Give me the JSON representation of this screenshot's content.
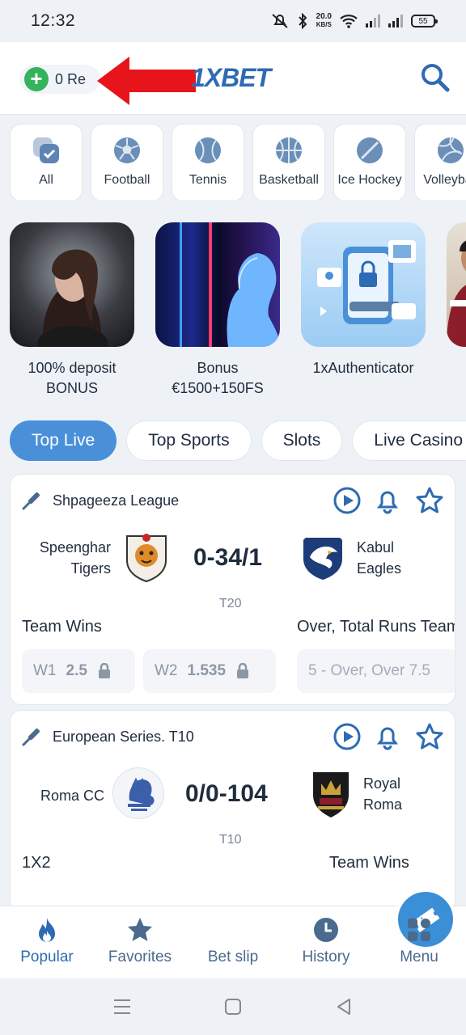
{
  "status": {
    "time": "12:32",
    "net_speed": "20.0",
    "net_unit": "KB/S",
    "battery": "55"
  },
  "header": {
    "balance": "0 Re",
    "logo": "1XBET",
    "arrow_color": "#e8141c"
  },
  "categories": [
    {
      "label": "All",
      "icon": "all-sports-icon"
    },
    {
      "label": "Football",
      "icon": "football-icon"
    },
    {
      "label": "Tennis",
      "icon": "tennis-icon"
    },
    {
      "label": "Basketball",
      "icon": "basketball-icon"
    },
    {
      "label": "Ice Hockey",
      "icon": "ice-hockey-icon"
    },
    {
      "label": "Volleyball",
      "icon": "volleyball-icon"
    }
  ],
  "promos": [
    {
      "title": "100% deposit\nBONUS"
    },
    {
      "title": "Bonus\n€1500+150FS"
    },
    {
      "title": "1xAuthenticator"
    }
  ],
  "tabs": [
    {
      "label": "Top Live",
      "active": true
    },
    {
      "label": "Top Sports"
    },
    {
      "label": "Slots"
    },
    {
      "label": "Live Casino"
    }
  ],
  "matches": [
    {
      "league": "Shpageeza League",
      "team1": "Speenghar\nTigers",
      "team2": "Kabul\nEagles",
      "score": "0-34/1",
      "format": "T20",
      "market1": "Team Wins",
      "market2": "Over, Total Runs Team",
      "odds": [
        {
          "k": "W1",
          "v": "2.5"
        },
        {
          "k": "W2",
          "v": "1.535"
        },
        {
          "k": "5 - Over, Over 7.5",
          "v": ""
        }
      ]
    },
    {
      "league": "European Series. T10",
      "team1": "Roma CC",
      "team2": "Royal\nRoma",
      "score": "0/0-104",
      "format": "T10",
      "market1": "1X2",
      "market2": "Team Wins"
    }
  ],
  "nav": {
    "popular": "Popular",
    "favorites": "Favorites",
    "betslip": "Bet slip",
    "history": "History",
    "menu": "Menu"
  },
  "colors": {
    "accent": "#2d6bb3",
    "tab_active": "#4a90d9",
    "plus_green": "#35b35a"
  }
}
